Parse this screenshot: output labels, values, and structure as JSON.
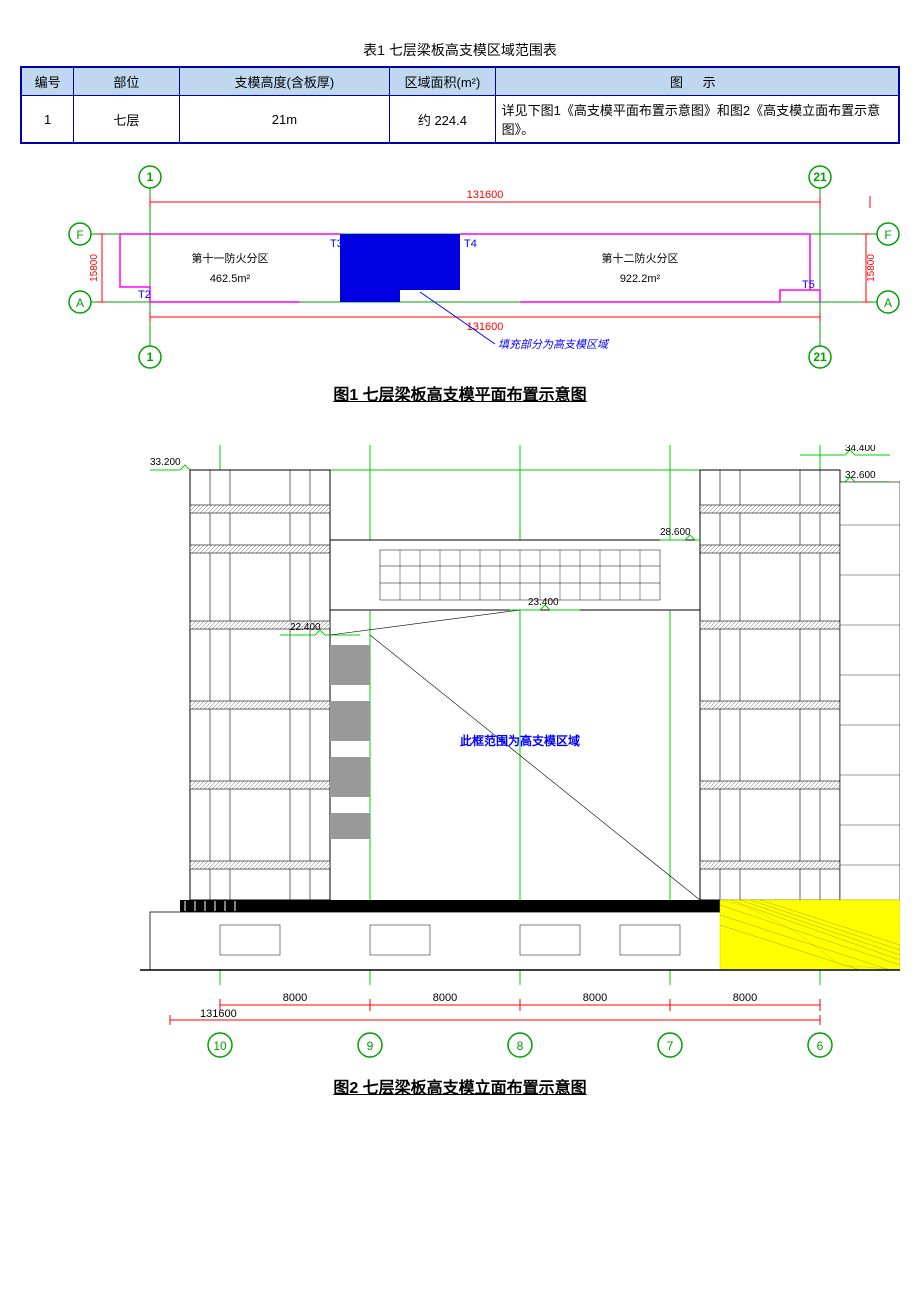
{
  "table": {
    "title": "表1 七层梁板高支模区域范围表",
    "headers": [
      "编号",
      "部位",
      "支模高度(含板厚)",
      "区域面积(m²)",
      "图  示"
    ],
    "row": {
      "num": "1",
      "part": "七层",
      "height": "21m",
      "area": "约 224.4",
      "note": "详见下图1《高支模平面布置示意图》和图2《高支模立面布置示意图》。"
    }
  },
  "fig1": {
    "caption": "图1  七层梁板高支模平面布置示意图",
    "dim_top": "131600",
    "dim_bottom": "131600",
    "dim_left": "15800",
    "dim_right": "15800",
    "grid_left": "1",
    "grid_right": "21",
    "grid_f": "F",
    "grid_a": "A",
    "zone11_title": "第十一防火分区",
    "zone11_area": "462.5m²",
    "zone12_title": "第十二防火分区",
    "zone12_area": "922.2m²",
    "t2": "T2",
    "t3": "T3",
    "t4": "T4",
    "t5": "T5",
    "fill_label": "填充部分为高支模区域"
  },
  "fig2": {
    "caption": "图2  七层梁板高支模立面布置示意图",
    "elev_33200": "33.200",
    "elev_34400": "34.400",
    "elev_32600": "32.600",
    "elev_28600": "28.600",
    "elev_23400": "23.400",
    "elev_22400": "22.400",
    "note": "此框范围为高支模区域",
    "grid10": "10",
    "grid9": "9",
    "grid8": "8",
    "grid7": "7",
    "grid6": "6",
    "span": "8000",
    "total": "131600"
  }
}
